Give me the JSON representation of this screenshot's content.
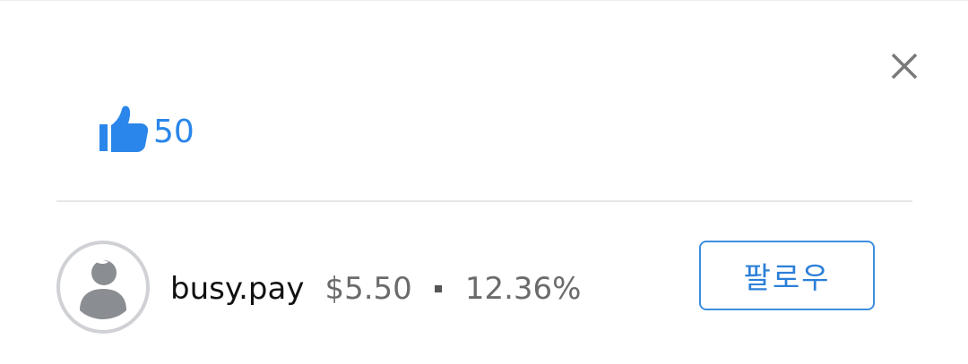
{
  "colors": {
    "accent": "#2a86ea",
    "icon_gray": "#7a7a7a",
    "avatar_gray": "#8a8d92",
    "divider": "#e6e6e6"
  },
  "dialog": {
    "close_icon": "close-icon"
  },
  "likes": {
    "icon": "thumbs-up-icon",
    "count": "50"
  },
  "author": {
    "avatar_icon": "default-avatar-icon",
    "name": "busy.pay",
    "payout": "$5.50",
    "separator_icon": "square-dot-icon",
    "percentage": "12.36%"
  },
  "follow": {
    "label": "팔로우"
  }
}
